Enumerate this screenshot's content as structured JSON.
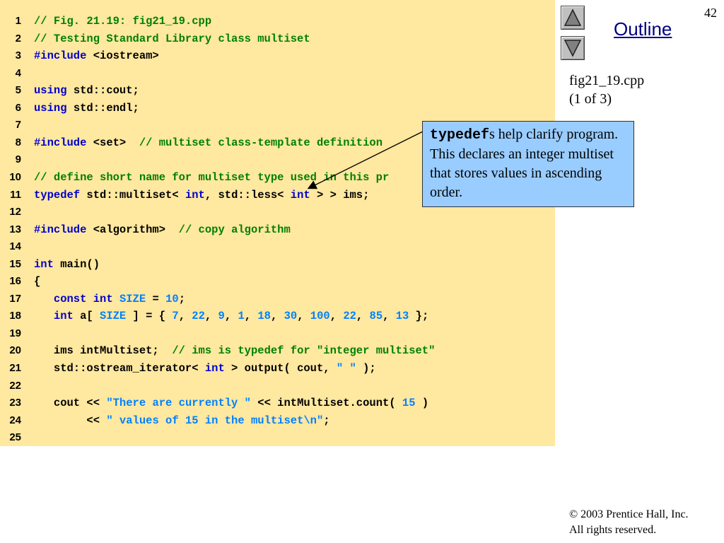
{
  "slide": {
    "page_number": "42",
    "outline_label": "Outline",
    "file_name": "fig21_19.cpp",
    "file_part": "(1 of 3)",
    "nav": {
      "up_icon": "triangle-up-icon",
      "down_icon": "triangle-down-icon"
    }
  },
  "callout": {
    "keyword": "typedef",
    "text_rest": "s help clarify program. This declares an integer multiset that stores values in ascending order."
  },
  "copyright": {
    "symbol": "©",
    "line1": " 2003 Prentice Hall, Inc.",
    "line2": "All rights reserved."
  },
  "colors": {
    "code_background": "#FFE8A0",
    "callout_background": "#99CCFF",
    "keyword": "#0000CC",
    "comment": "#008000",
    "literal": "#0080FF"
  },
  "code": [
    {
      "num": "1",
      "tokens": [
        {
          "t": "cm",
          "v": "// Fig. 21.19: fig21_19.cpp"
        }
      ]
    },
    {
      "num": "2",
      "tokens": [
        {
          "t": "cm",
          "v": "// Testing Standard Library class multiset"
        }
      ]
    },
    {
      "num": "3",
      "tokens": [
        {
          "t": "kw",
          "v": "#include"
        },
        {
          "t": "plain",
          "v": " <iostream>"
        }
      ]
    },
    {
      "num": "4",
      "tokens": []
    },
    {
      "num": "5",
      "tokens": [
        {
          "t": "kw",
          "v": "using"
        },
        {
          "t": "plain",
          "v": " std::cout;"
        }
      ]
    },
    {
      "num": "6",
      "tokens": [
        {
          "t": "kw",
          "v": "using"
        },
        {
          "t": "plain",
          "v": " std::endl;"
        }
      ]
    },
    {
      "num": "7",
      "tokens": []
    },
    {
      "num": "8",
      "tokens": [
        {
          "t": "kw",
          "v": "#include"
        },
        {
          "t": "plain",
          "v": " <set>  "
        },
        {
          "t": "cm",
          "v": "// multiset class-template definition"
        }
      ]
    },
    {
      "num": "9",
      "tokens": []
    },
    {
      "num": "10",
      "tokens": [
        {
          "t": "cm",
          "v": "// define short name for multiset type used in this pr"
        }
      ]
    },
    {
      "num": "11",
      "tokens": [
        {
          "t": "kw",
          "v": "typedef"
        },
        {
          "t": "plain",
          "v": " std::multiset< "
        },
        {
          "t": "kw",
          "v": "int"
        },
        {
          "t": "plain",
          "v": ", std::less< "
        },
        {
          "t": "kw",
          "v": "int"
        },
        {
          "t": "plain",
          "v": " > > ims;"
        }
      ]
    },
    {
      "num": "12",
      "tokens": []
    },
    {
      "num": "13",
      "tokens": [
        {
          "t": "kw",
          "v": "#include"
        },
        {
          "t": "plain",
          "v": " <algorithm>  "
        },
        {
          "t": "cm",
          "v": "// copy algorithm"
        }
      ]
    },
    {
      "num": "14",
      "tokens": []
    },
    {
      "num": "15",
      "tokens": [
        {
          "t": "kw",
          "v": "int"
        },
        {
          "t": "plain",
          "v": " main()"
        }
      ]
    },
    {
      "num": "16",
      "tokens": [
        {
          "t": "plain",
          "v": "{"
        }
      ]
    },
    {
      "num": "17",
      "tokens": [
        {
          "t": "plain",
          "v": "   "
        },
        {
          "t": "kw",
          "v": "const"
        },
        {
          "t": "plain",
          "v": " "
        },
        {
          "t": "kw",
          "v": "int"
        },
        {
          "t": "plain",
          "v": " "
        },
        {
          "t": "str",
          "v": "SIZE"
        },
        {
          "t": "plain",
          "v": " = "
        },
        {
          "t": "num",
          "v": "10"
        },
        {
          "t": "plain",
          "v": ";"
        }
      ]
    },
    {
      "num": "18",
      "tokens": [
        {
          "t": "plain",
          "v": "   "
        },
        {
          "t": "kw",
          "v": "int"
        },
        {
          "t": "plain",
          "v": " a[ "
        },
        {
          "t": "str",
          "v": "SIZE"
        },
        {
          "t": "plain",
          "v": " ] = { "
        },
        {
          "t": "num",
          "v": "7"
        },
        {
          "t": "plain",
          "v": ", "
        },
        {
          "t": "num",
          "v": "22"
        },
        {
          "t": "plain",
          "v": ", "
        },
        {
          "t": "num",
          "v": "9"
        },
        {
          "t": "plain",
          "v": ", "
        },
        {
          "t": "num",
          "v": "1"
        },
        {
          "t": "plain",
          "v": ", "
        },
        {
          "t": "num",
          "v": "18"
        },
        {
          "t": "plain",
          "v": ", "
        },
        {
          "t": "num",
          "v": "30"
        },
        {
          "t": "plain",
          "v": ", "
        },
        {
          "t": "num",
          "v": "100"
        },
        {
          "t": "plain",
          "v": ", "
        },
        {
          "t": "num",
          "v": "22"
        },
        {
          "t": "plain",
          "v": ", "
        },
        {
          "t": "num",
          "v": "85"
        },
        {
          "t": "plain",
          "v": ", "
        },
        {
          "t": "num",
          "v": "13"
        },
        {
          "t": "plain",
          "v": " };"
        }
      ]
    },
    {
      "num": "19",
      "tokens": []
    },
    {
      "num": "20",
      "tokens": [
        {
          "t": "plain",
          "v": "   ims intMultiset;  "
        },
        {
          "t": "cm",
          "v": "// ims is typedef for \"integer multiset\""
        }
      ]
    },
    {
      "num": "21",
      "tokens": [
        {
          "t": "plain",
          "v": "   std::ostream_iterator< "
        },
        {
          "t": "kw",
          "v": "int"
        },
        {
          "t": "plain",
          "v": " > output( cout, "
        },
        {
          "t": "str",
          "v": "\" \""
        },
        {
          "t": "plain",
          "v": " );"
        }
      ]
    },
    {
      "num": "22",
      "tokens": []
    },
    {
      "num": "23",
      "tokens": [
        {
          "t": "plain",
          "v": "   cout << "
        },
        {
          "t": "str",
          "v": "\"There are currently \""
        },
        {
          "t": "plain",
          "v": " << intMultiset.count( "
        },
        {
          "t": "num",
          "v": "15"
        },
        {
          "t": "plain",
          "v": " )"
        }
      ]
    },
    {
      "num": "24",
      "tokens": [
        {
          "t": "plain",
          "v": "        << "
        },
        {
          "t": "str",
          "v": "\" values of 15 in the multiset\\n\""
        },
        {
          "t": "plain",
          "v": ";"
        }
      ]
    },
    {
      "num": "25",
      "tokens": []
    }
  ]
}
